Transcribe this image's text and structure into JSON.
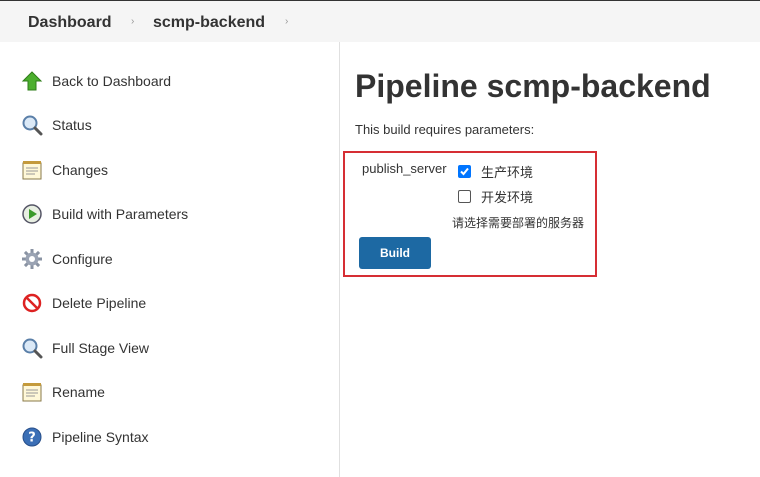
{
  "breadcrumb": {
    "items": [
      "Dashboard",
      "scmp-backend"
    ],
    "separator": "›"
  },
  "sidebar": {
    "items": [
      {
        "label": "Back to Dashboard",
        "icon": "green-up-arrow-icon"
      },
      {
        "label": "Status",
        "icon": "magnifier-icon"
      },
      {
        "label": "Changes",
        "icon": "notepad-icon"
      },
      {
        "label": "Build with Parameters",
        "icon": "build-clock-icon"
      },
      {
        "label": "Configure",
        "icon": "gear-icon"
      },
      {
        "label": "Delete Pipeline",
        "icon": "no-entry-icon"
      },
      {
        "label": "Full Stage View",
        "icon": "magnifier-icon"
      },
      {
        "label": "Rename",
        "icon": "notepad-icon"
      },
      {
        "label": "Pipeline Syntax",
        "icon": "help-icon"
      }
    ]
  },
  "main": {
    "title": "Pipeline scmp-backend",
    "requires_text": "This build requires parameters:",
    "parameter": {
      "name": "publish_server",
      "options": [
        {
          "label": "生产环境",
          "checked": true
        },
        {
          "label": "开发环境",
          "checked": false
        }
      ],
      "description": "请选择需要部署的服务器"
    },
    "build_label": "Build"
  },
  "colors": {
    "accent": "#1d69a3",
    "highlight_border": "#d62e34",
    "checkbox_checked": "#0075ff"
  }
}
